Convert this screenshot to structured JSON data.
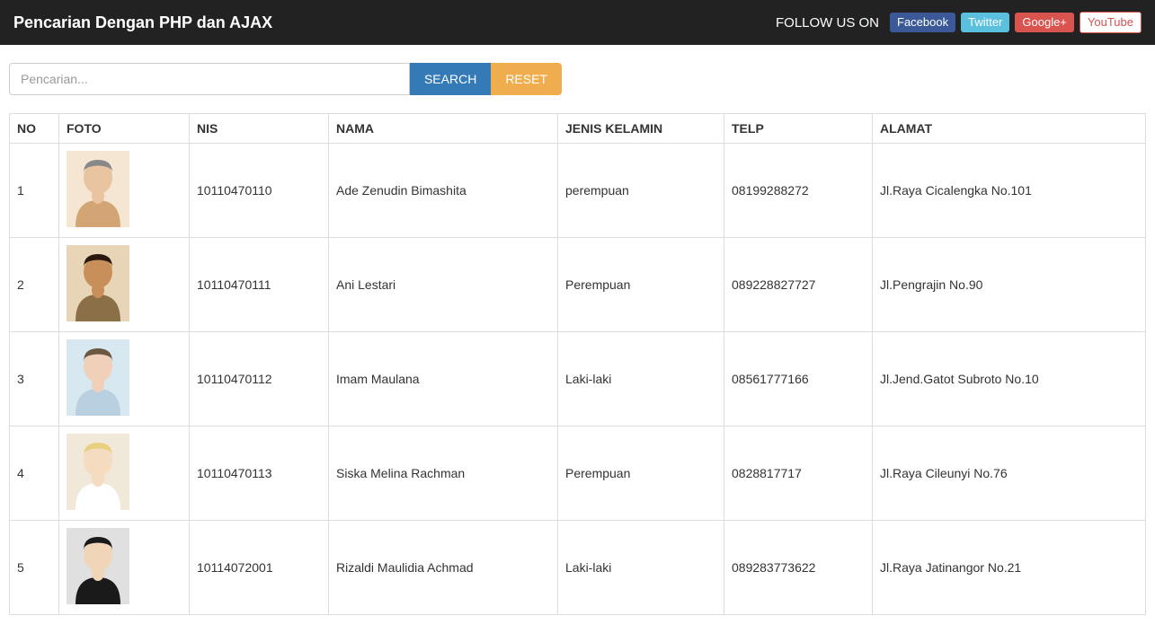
{
  "header": {
    "title": "Pencarian Dengan PHP dan AJAX",
    "follow_text": "FOLLOW US ON",
    "social": {
      "facebook": "Facebook",
      "twitter": "Twitter",
      "google": "Google+",
      "youtube": "YouTube"
    }
  },
  "search": {
    "placeholder": "Pencarian...",
    "search_btn": "SEARCH",
    "reset_btn": "RESET"
  },
  "table": {
    "headers": {
      "no": "NO",
      "foto": "FOTO",
      "nis": "NIS",
      "nama": "NAMA",
      "jenis_kelamin": "JENIS KELAMIN",
      "telp": "TELP",
      "alamat": "ALAMAT"
    },
    "rows": [
      {
        "no": "1",
        "nis": "10110470110",
        "nama": "Ade Zenudin Bimashita",
        "jenis_kelamin": "perempuan",
        "telp": "08199288272",
        "alamat": "Jl.Raya Cicalengka No.101"
      },
      {
        "no": "2",
        "nis": "10110470111",
        "nama": "Ani Lestari",
        "jenis_kelamin": "Perempuan",
        "telp": "089228827727",
        "alamat": "Jl.Pengrajin No.90"
      },
      {
        "no": "3",
        "nis": "10110470112",
        "nama": "Imam Maulana",
        "jenis_kelamin": "Laki-laki",
        "telp": "08561777166",
        "alamat": "Jl.Jend.Gatot Subroto No.10"
      },
      {
        "no": "4",
        "nis": "10110470113",
        "nama": "Siska Melina Rachman",
        "jenis_kelamin": "Perempuan",
        "telp": "0828817717",
        "alamat": "Jl.Raya Cileunyi No.76"
      },
      {
        "no": "5",
        "nis": "10114072001",
        "nama": "Rizaldi Maulidia Achmad",
        "jenis_kelamin": "Laki-laki",
        "telp": "089283773622",
        "alamat": "Jl.Raya Jatinangor No.21"
      }
    ]
  }
}
